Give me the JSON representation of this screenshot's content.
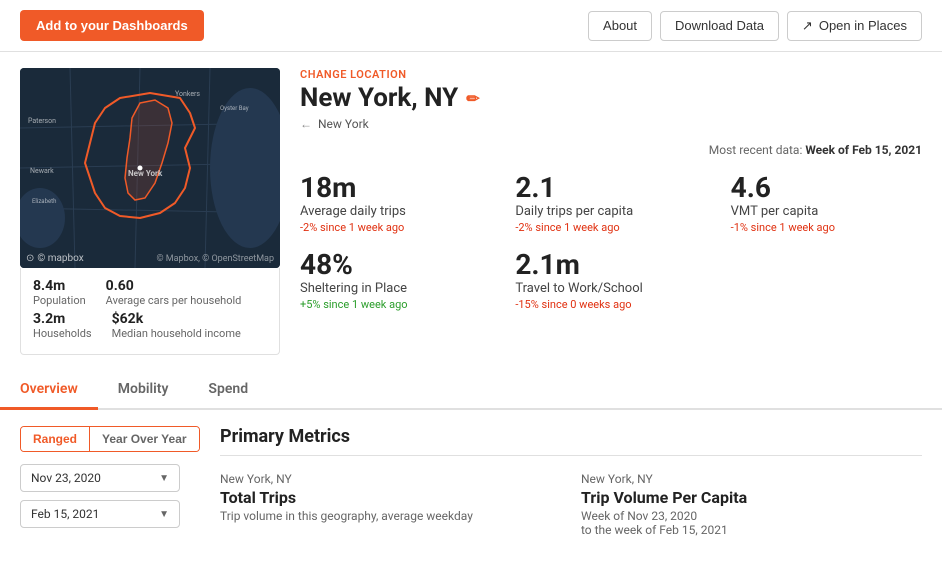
{
  "toolbar": {
    "add_dashboard_label": "Add to your Dashboards",
    "about_label": "About",
    "download_label": "Download Data",
    "open_places_label": "Open in Places"
  },
  "location": {
    "change_label": "Change Location",
    "city": "New York, NY",
    "breadcrumb_parent": "New York",
    "data_date_label": "Most recent data:",
    "data_date_value": "Week of Feb 15, 2021"
  },
  "metrics": [
    {
      "value": "18m",
      "label": "Average daily trips",
      "change": "-2% since 1 week ago",
      "change_type": "negative"
    },
    {
      "value": "2.1",
      "label": "Daily trips per capita",
      "change": "-2% since 1 week ago",
      "change_type": "negative"
    },
    {
      "value": "4.6",
      "label": "VMT per capita",
      "change": "-1% since 1 week ago",
      "change_type": "negative"
    },
    {
      "value": "48%",
      "label": "Sheltering in Place",
      "change": "+5% since 1 week ago",
      "change_type": "positive"
    },
    {
      "value": "2.1m",
      "label": "Travel to Work/School",
      "change": "-15% since 0 weeks ago",
      "change_type": "negative"
    }
  ],
  "location_stats": {
    "population_value": "8.4m",
    "population_label": "Population",
    "households_value": "3.2m",
    "households_label": "Households",
    "avg_cars_value": "0.60",
    "avg_cars_label": "Average cars per household",
    "median_income_value": "$62k",
    "median_income_label": "Median household income"
  },
  "tabs": [
    {
      "label": "Overview",
      "active": true
    },
    {
      "label": "Mobility",
      "active": false
    },
    {
      "label": "Spend",
      "active": false
    }
  ],
  "filter": {
    "ranged_label": "Ranged",
    "yoy_label": "Year Over Year",
    "date_from": "Nov 23, 2020",
    "date_to": "Feb 15, 2021"
  },
  "primary_metrics": {
    "section_title": "Primary Metrics",
    "cards": [
      {
        "location": "New York, NY",
        "title": "Total Trips",
        "desc": "Trip volume in this geography, average weekday"
      },
      {
        "location": "New York, NY",
        "title": "Trip Volume Per Capita",
        "desc": "Week of Nov 23, 2020\nto the week of Feb 15, 2021"
      }
    ]
  },
  "mapbox_label": "© mapbox",
  "map_copyright": "© Mapbox, © OpenStreetMap"
}
